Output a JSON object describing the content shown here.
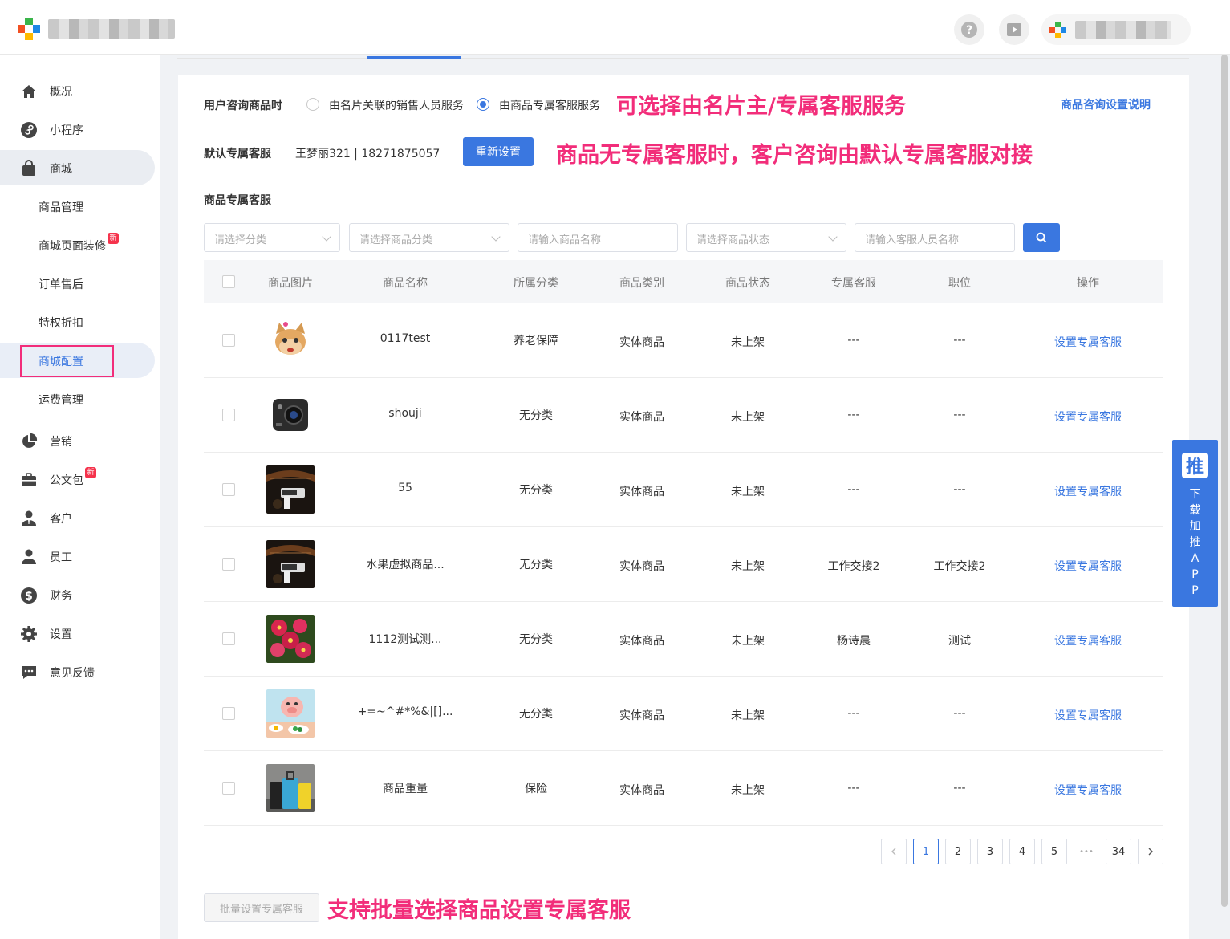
{
  "sidebar": {
    "items": [
      {
        "label": "概况",
        "icon": "home-icon"
      },
      {
        "label": "小程序",
        "icon": "mini-program-icon"
      },
      {
        "label": "商城",
        "icon": "shopping-bag-icon"
      },
      {
        "label": "营销",
        "icon": "pie-chart-icon"
      },
      {
        "label": "公文包",
        "icon": "briefcase-icon",
        "badge": "新"
      },
      {
        "label": "客户",
        "icon": "customer-icon"
      },
      {
        "label": "员工",
        "icon": "staff-icon"
      },
      {
        "label": "财务",
        "icon": "dollar-icon"
      },
      {
        "label": "设置",
        "icon": "gear-icon"
      },
      {
        "label": "意见反馈",
        "icon": "feedback-icon"
      }
    ],
    "mall_sub": [
      {
        "label": "商品管理"
      },
      {
        "label": "商城页面装修",
        "badge": "新"
      },
      {
        "label": "订单售后"
      },
      {
        "label": "特权折扣"
      },
      {
        "label": "商城配置"
      },
      {
        "label": "运费管理"
      }
    ]
  },
  "settings": {
    "consult_label": "用户咨询商品时",
    "option1": "由名片关联的销售人员服务",
    "option2": "由商品专属客服服务",
    "selected": "option2",
    "help_link": "商品咨询设置说明",
    "default_label": "默认专属客服",
    "default_value": "王梦丽321 | 18271875057",
    "reset_button": "重新设置",
    "section_title": "商品专属客服"
  },
  "annotations": {
    "a1": "可选择由名片主/专属客服服务",
    "a2": "商品无专属客服时，客户咨询由默认专属客服对接",
    "a3": "支持批量选择商品设置专属客服"
  },
  "filters": {
    "category": "请选择分类",
    "product_category": "请选择商品分类",
    "product_name": "请输入商品名称",
    "product_status": "请选择商品状态",
    "staff_name": "请输入客服人员名称"
  },
  "table": {
    "headers": [
      "商品图片",
      "商品名称",
      "所属分类",
      "商品类别",
      "商品状态",
      "专属客服",
      "职位",
      "操作"
    ],
    "rows": [
      {
        "name": "0117test",
        "category": "养老保障",
        "type": "实体商品",
        "status": "未上架",
        "staff": "---",
        "position": "---",
        "action": "设置专属客服"
      },
      {
        "name": "shouji",
        "category": "无分类",
        "type": "实体商品",
        "status": "未上架",
        "staff": "---",
        "position": "---",
        "action": "设置专属客服"
      },
      {
        "name": "55",
        "category": "无分类",
        "type": "实体商品",
        "status": "未上架",
        "staff": "---",
        "position": "---",
        "action": "设置专属客服"
      },
      {
        "name": "水果虚拟商品...",
        "category": "无分类",
        "type": "实体商品",
        "status": "未上架",
        "staff": "工作交接2",
        "position": "工作交接2",
        "action": "设置专属客服"
      },
      {
        "name": "1112测试测...",
        "category": "无分类",
        "type": "实体商品",
        "status": "未上架",
        "staff": "杨诗晨",
        "position": "测试",
        "action": "设置专属客服"
      },
      {
        "name": "+=~^#*%&|[]...",
        "category": "无分类",
        "type": "实体商品",
        "status": "未上架",
        "staff": "---",
        "position": "---",
        "action": "设置专属客服"
      },
      {
        "name": "商品重量",
        "category": "保险",
        "type": "实体商品",
        "status": "未上架",
        "staff": "---",
        "position": "---",
        "action": "设置专属客服"
      }
    ]
  },
  "pagination": {
    "pages": [
      "1",
      "2",
      "3",
      "4",
      "5"
    ],
    "current": "1",
    "ellipsis": "•••",
    "last": "34"
  },
  "batch_button": "批量设置专属客服",
  "float_app": {
    "logo": "推",
    "chars": [
      "下",
      "载",
      "加",
      "推",
      "A",
      "P",
      "P"
    ]
  },
  "colors": {
    "accent": "#3a77e0",
    "annotation": "#f22d7a"
  }
}
